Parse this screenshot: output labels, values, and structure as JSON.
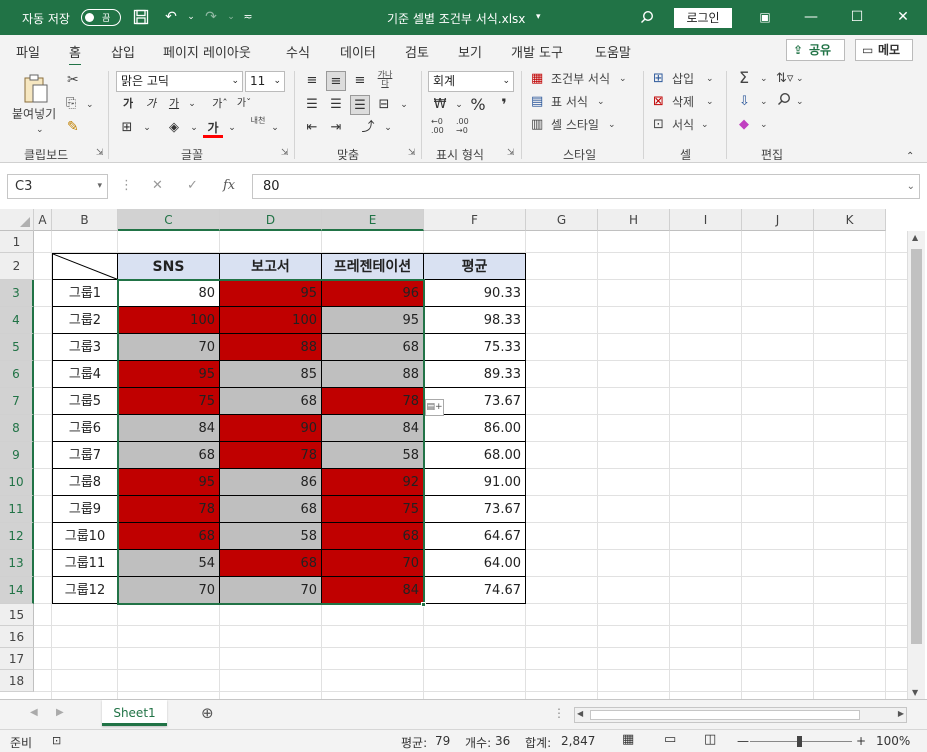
{
  "titlebar": {
    "autosave_label": "자동 저장",
    "autosave_state": "끔",
    "filename": "기준 셀별 조건부 서식.xlsx",
    "login_label": "로그인"
  },
  "menu": {
    "items": [
      "파일",
      "홈",
      "삽입",
      "페이지 레이아웃",
      "수식",
      "데이터",
      "검토",
      "보기",
      "개발 도구",
      "도움말"
    ],
    "active": "홈",
    "share_label": "공유",
    "memo_label": "메모"
  },
  "ribbon": {
    "paste_label": "붙여넣기",
    "font_name": "맑은 고딕",
    "font_size": "11",
    "number_format": "회계",
    "cond_format_label": "조건부 서식",
    "table_format_label": "표 서식",
    "cell_style_label": "셀 스타일",
    "insert_label": "삽입",
    "delete_label": "삭제",
    "format_label": "서식",
    "groups": {
      "clipboard": "클립보드",
      "font": "글꼴",
      "alignment": "맞춤",
      "number": "표시 형식",
      "styles": "스타일",
      "cells": "셀",
      "editing": "편집"
    },
    "wrap_label": "가나다",
    "phonetic_label": "내천"
  },
  "formula": {
    "name_box": "C3",
    "value": "80"
  },
  "grid": {
    "columns": [
      "A",
      "B",
      "C",
      "D",
      "E",
      "F",
      "G",
      "H",
      "I",
      "J",
      "K"
    ],
    "rows": [
      "1",
      "2",
      "3",
      "4",
      "5",
      "6",
      "7",
      "8",
      "9",
      "10",
      "11",
      "12",
      "13",
      "14",
      "15",
      "16",
      "17",
      "18"
    ],
    "headers": [
      "SNS",
      "보고서",
      "프레젠테이션",
      "평균"
    ],
    "groups": [
      "그룹1",
      "그룹2",
      "그룹3",
      "그룹4",
      "그룹5",
      "그룹6",
      "그룹7",
      "그룹8",
      "그룹9",
      "그룹10",
      "그룹11",
      "그룹12"
    ],
    "values": [
      [
        "80",
        "95",
        "96",
        "90.33"
      ],
      [
        "100",
        "100",
        "95",
        "98.33"
      ],
      [
        "70",
        "88",
        "68",
        "75.33"
      ],
      [
        "95",
        "85",
        "88",
        "89.33"
      ],
      [
        "75",
        "68",
        "78",
        "73.67"
      ],
      [
        "84",
        "90",
        "84",
        "86.00"
      ],
      [
        "68",
        "78",
        "58",
        "68.00"
      ],
      [
        "95",
        "86",
        "92",
        "91.00"
      ],
      [
        "78",
        "68",
        "75",
        "73.67"
      ],
      [
        "68",
        "58",
        "68",
        "64.67"
      ],
      [
        "54",
        "68",
        "70",
        "64.00"
      ],
      [
        "70",
        "70",
        "84",
        "74.67"
      ]
    ],
    "fill_pattern": [
      [
        "none",
        "red",
        "red"
      ],
      [
        "red",
        "red",
        "gray"
      ],
      [
        "gray",
        "red",
        "gray"
      ],
      [
        "red",
        "gray",
        "gray"
      ],
      [
        "red",
        "gray",
        "red"
      ],
      [
        "gray",
        "red",
        "gray"
      ],
      [
        "gray",
        "red",
        "gray"
      ],
      [
        "red",
        "gray",
        "red"
      ],
      [
        "red",
        "gray",
        "red"
      ],
      [
        "red",
        "gray",
        "red"
      ],
      [
        "gray",
        "red",
        "red"
      ],
      [
        "gray",
        "gray",
        "red"
      ]
    ],
    "colors": {
      "red": "#c00000",
      "gray": "#bfbfbf",
      "header": "#d9e1f2",
      "accent": "#217346"
    }
  },
  "sheet_tab": "Sheet1",
  "status": {
    "ready": "준비",
    "average_label": "평균:",
    "average_value": "79",
    "count_label": "개수:",
    "count_value": "36",
    "sum_label": "합계:",
    "sum_value": "2,847",
    "zoom": "100%"
  }
}
